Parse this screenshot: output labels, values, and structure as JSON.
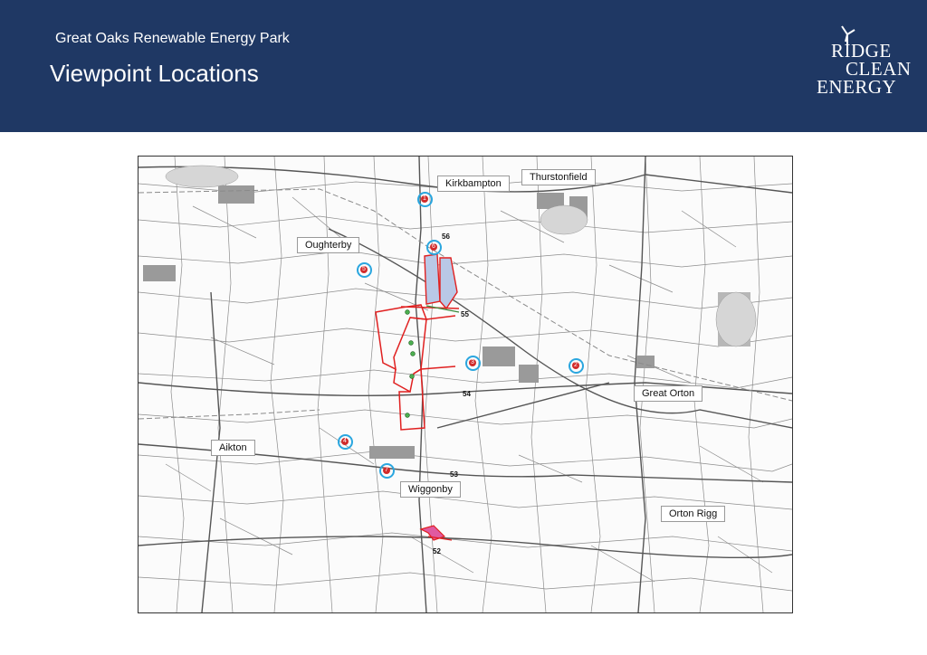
{
  "header": {
    "subtitle": "Great Oaks Renewable Energy Park",
    "title": "Viewpoint Locations",
    "logo": {
      "line1": "RIDGE",
      "line2": "CLEAN",
      "line3": "ENERGY"
    }
  },
  "colors": {
    "header_bg": "#1f3864",
    "viewpoint_ring": "#2aa6df",
    "viewpoint_marker": "#d12b2b",
    "site_boundary": "#e02020",
    "site_fill": "#b9c8e6"
  },
  "map": {
    "place_labels": [
      "Kirkbampton",
      "Thurstonfield",
      "Oughterby",
      "Great Orton",
      "Aikton",
      "Wiggonby",
      "Orton Rigg"
    ],
    "viewpoints": [
      "1",
      "2",
      "3",
      "4",
      "5",
      "6",
      "7"
    ],
    "spot_heights": [
      "56",
      "55",
      "54",
      "53",
      "52"
    ]
  }
}
